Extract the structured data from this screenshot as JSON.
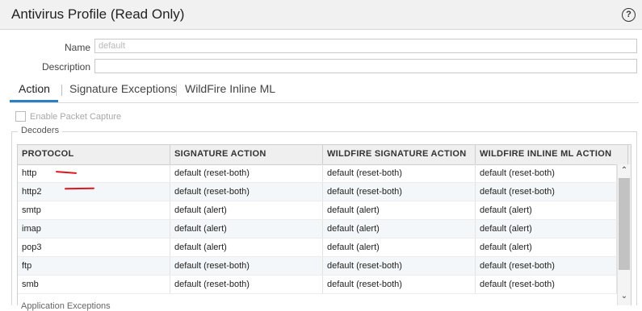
{
  "window": {
    "title": "Antivirus Profile (Read Only)",
    "help_icon": "?"
  },
  "form": {
    "name_label": "Name",
    "name_value": "default",
    "description_label": "Description",
    "description_value": ""
  },
  "tabs": [
    {
      "label": "Action",
      "active": true
    },
    {
      "label": "Signature Exceptions",
      "active": false
    },
    {
      "label": "WildFire Inline ML",
      "active": false
    }
  ],
  "packet_capture": {
    "label": "Enable Packet Capture",
    "checked": false
  },
  "decoders": {
    "legend": "Decoders",
    "columns": [
      "PROTOCOL",
      "SIGNATURE ACTION",
      "WILDFIRE SIGNATURE ACTION",
      "WILDFIRE INLINE ML ACTION"
    ],
    "rows": [
      [
        "http",
        "default (reset-both)",
        "default (reset-both)",
        "default (reset-both)"
      ],
      [
        "http2",
        "default (reset-both)",
        "default (reset-both)",
        "default (reset-both)"
      ],
      [
        "smtp",
        "default (alert)",
        "default (alert)",
        "default (alert)"
      ],
      [
        "imap",
        "default (alert)",
        "default (alert)",
        "default (alert)"
      ],
      [
        "pop3",
        "default (alert)",
        "default (alert)",
        "default (alert)"
      ],
      [
        "ftp",
        "default (reset-both)",
        "default (reset-both)",
        "default (reset-both)"
      ],
      [
        "smb",
        "default (reset-both)",
        "default (reset-both)",
        "default (reset-both)"
      ]
    ]
  },
  "next_section_label": "Application Exceptions",
  "colors": {
    "accent": "#2b7fc1",
    "annotation": "#e3131c",
    "alt_row": "#f3f7f9"
  }
}
